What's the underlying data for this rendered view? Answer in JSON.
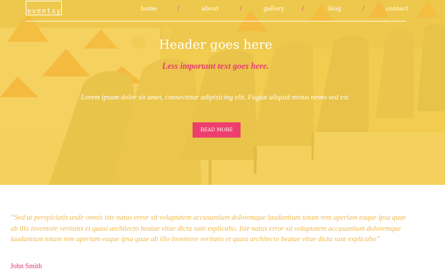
{
  "nav": {
    "logo": "eventsy",
    "items": [
      "home",
      "about",
      "gallery",
      "blog",
      "contact"
    ],
    "separator": "/"
  },
  "hero": {
    "title": "Header goes here",
    "subtitle": "Less important text goes here.",
    "body": "Lorem ipsum dolor sit amet, consectetur adipisicing elit. Fugiat aliquid minus nemo sed est.",
    "button_label": "READ MORE"
  },
  "testimonial": {
    "quote": "“Sed ut perspiciatis unde omnis iste natus error sit voluptatem accusantium doloremque laudantium totam rem aperiam eaque ipsa quae ab illo inventore veritatis et quasi architecto beatae vitae dicta sunt explicabo. Iste natus error sit voluptatem accusantium doloremque laudantium totam rem aperiam eaque ipsa quae ab illo inventore veritatis et quasi architecto beatae vitae dicta sunt explicabo”",
    "author": "John Smith"
  },
  "colors": {
    "overlay_yellow": "#f8cf46",
    "accent_pink": "#ec3f6d",
    "quote_yellow": "#f2b846",
    "white": "#ffffff"
  }
}
